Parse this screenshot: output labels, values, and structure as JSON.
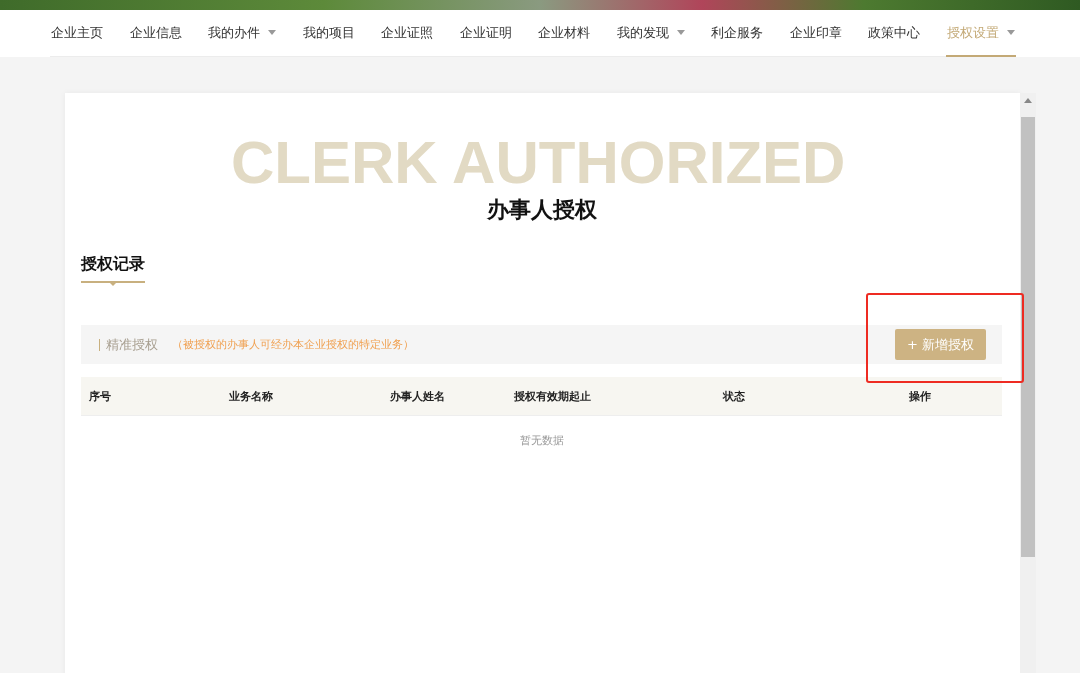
{
  "nav": {
    "items": [
      {
        "label": "企业主页",
        "selected": false,
        "dropdown": false
      },
      {
        "label": "企业信息",
        "selected": false,
        "dropdown": false
      },
      {
        "label": "我的办件",
        "selected": false,
        "dropdown": true
      },
      {
        "label": "我的项目",
        "selected": false,
        "dropdown": false
      },
      {
        "label": "企业证照",
        "selected": false,
        "dropdown": false
      },
      {
        "label": "企业证明",
        "selected": false,
        "dropdown": false
      },
      {
        "label": "企业材料",
        "selected": false,
        "dropdown": false
      },
      {
        "label": "我的发现",
        "selected": false,
        "dropdown": true
      },
      {
        "label": "利企服务",
        "selected": false,
        "dropdown": false
      },
      {
        "label": "企业印章",
        "selected": false,
        "dropdown": false
      },
      {
        "label": "政策中心",
        "selected": false,
        "dropdown": false
      },
      {
        "label": "授权设置",
        "selected": true,
        "dropdown": true
      }
    ]
  },
  "page": {
    "watermark": "CLERK AUTHORIZED",
    "title": "办事人授权",
    "section_title": "授权记录"
  },
  "toolbar": {
    "label": "精准授权",
    "hint": "（被授权的办事人可经办本企业授权的特定业务）",
    "add_button": {
      "label": "+ 新增授权",
      "highlighted": true
    }
  },
  "table": {
    "columns": [
      "序号",
      "业务名称",
      "办事人姓名",
      "授权有效期起止",
      "状态",
      "操作"
    ],
    "empty_text": "暂无数据"
  }
}
